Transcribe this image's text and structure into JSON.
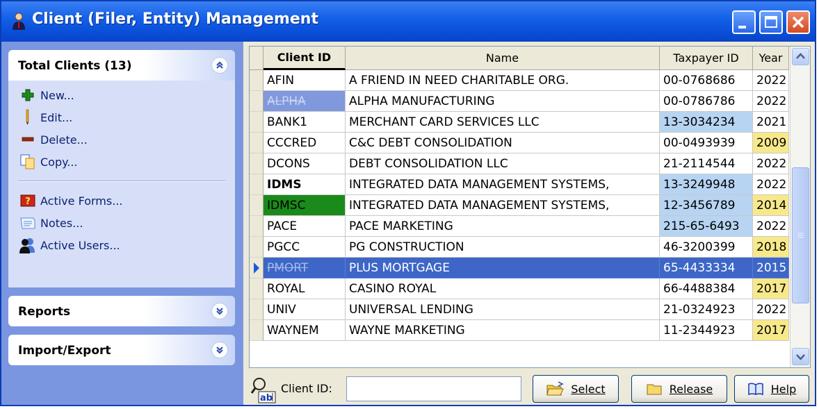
{
  "window": {
    "title": "Client (Filer, Entity) Management",
    "controls": [
      "minimize",
      "maximize",
      "close"
    ]
  },
  "sidebar": {
    "total_clients": {
      "label": "Total Clients (13)",
      "items": [
        {
          "label": "New...",
          "icon": "plus-icon"
        },
        {
          "label": "Edit...",
          "icon": "pencil-icon"
        },
        {
          "label": "Delete...",
          "icon": "minus-icon"
        },
        {
          "label": "Copy...",
          "icon": "copy-icon"
        },
        {
          "label": "Active Forms...",
          "icon": "forms-icon"
        },
        {
          "label": "Notes...",
          "icon": "notes-icon"
        },
        {
          "label": "Active Users...",
          "icon": "users-icon"
        }
      ]
    },
    "reports": {
      "label": "Reports"
    },
    "import_export": {
      "label": "Import/Export"
    }
  },
  "grid": {
    "columns": [
      "Client ID",
      "Name",
      "Taxpayer ID",
      "Year"
    ],
    "rows": [
      {
        "id": "AFIN",
        "name": "A FRIEND IN NEED CHARITABLE ORG.",
        "tin": "00-0768686",
        "year": "2022"
      },
      {
        "id": "ALPHA",
        "name": "ALPHA MANUFACTURING",
        "tin": "00-0786786",
        "year": "2022"
      },
      {
        "id": "BANK1",
        "name": "MERCHANT CARD SERVICES LLC",
        "tin": "13-3034234",
        "year": "2021"
      },
      {
        "id": "CCCRED",
        "name": "C&C DEBT CONSOLIDATION",
        "tin": "00-0493939",
        "year": "2009"
      },
      {
        "id": "DCONS",
        "name": "DEBT CONSOLIDATION LLC",
        "tin": "21-2114544",
        "year": "2022"
      },
      {
        "id": "IDMS",
        "name": "INTEGRATED DATA MANAGEMENT SYSTEMS,",
        "tin": "13-3249948",
        "year": "2022"
      },
      {
        "id": "IDMSC",
        "name": "INTEGRATED DATA MANAGEMENT SYSTEMS,",
        "tin": "12-3456789",
        "year": "2014"
      },
      {
        "id": "PACE",
        "name": "PACE MARKETING",
        "tin": "215-65-6493",
        "year": "2022"
      },
      {
        "id": "PGCC",
        "name": "PG CONSTRUCTION",
        "tin": "46-3200399",
        "year": "2018"
      },
      {
        "id": "PMORT",
        "name": "PLUS MORTGAGE",
        "tin": "65-4433334",
        "year": "2015"
      },
      {
        "id": "ROYAL",
        "name": "CASINO ROYAL",
        "tin": "66-4488384",
        "year": "2017"
      },
      {
        "id": "UNIV",
        "name": "UNIVERSAL LENDING",
        "tin": "21-0324923",
        "year": "2022"
      },
      {
        "id": "WAYNEM",
        "name": "WAYNE MARKETING",
        "tin": "11-2344923",
        "year": "2017"
      }
    ],
    "selected_row": "PMORT"
  },
  "bottom": {
    "client_id_label": "Client ID:",
    "client_id_value": "",
    "select_label": "Select",
    "release_label": "Release",
    "help_label": "Help"
  },
  "colors": {
    "title_bar": "#1561e8",
    "sidebar_bg": "#7b96e0",
    "selection": "#3d66c7",
    "highlight_blue": "#b7d4f2",
    "highlight_yellow": "#f7e98a",
    "highlight_green": "#1a8a1a"
  }
}
